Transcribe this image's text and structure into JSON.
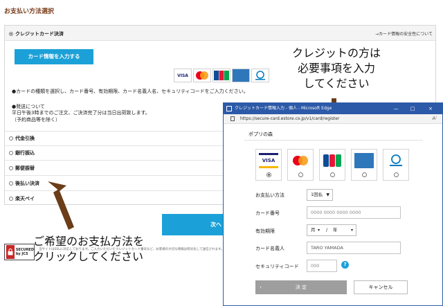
{
  "page": {
    "section_title": "お支払い方法選択",
    "credit_label": "クレジットカード決済",
    "security_link": "→カード情報の安全性について",
    "card_button": "カード情報を入力する",
    "card_logos": [
      "VISA",
      "MasterCard",
      "JCB",
      "AMEX",
      "Diners Club"
    ],
    "notice_line1": "●カードの種類を選択し、カード番号、有効期限、カード名義人名、セキュリティコードをご入力ください。",
    "notice_ship_title": "●発送について",
    "notice_ship_line1": "平日午後3時までのご注文、ご決済完了分は当日出荷致します。",
    "notice_ship_line2": "（予約商品等を除く）",
    "methods": [
      "代金引換",
      "銀行振込",
      "郵便振替",
      "後払い決済",
      "楽天ペイ"
    ],
    "next_button": "次へ",
    "seal_line1": "SECURED",
    "seal_line2": "by JCS",
    "ssl_text": "当サイトはSSLに対応しております。ご入力いただいたクレジットカード番号など、お客様の大切な情報は暗号化して送信されます。"
  },
  "annotations": {
    "top_line1": "クレジットの方は",
    "top_line2": "必要事項を入力",
    "top_line3": "してください",
    "bottom_line1": "ご希望のお支払方法を",
    "bottom_line2": "クリックしてください"
  },
  "popup": {
    "title": "クレジットカード情報入力 - 個人 - Microsoft Edge",
    "controls": [
      "—",
      "□",
      "×"
    ],
    "url": "https://secure-card.estore.co.jp/v1/card/register",
    "reader_icon": "A⁾",
    "shop_name": "ポプリの森",
    "brands": [
      {
        "name": "VISA",
        "selected": true
      },
      {
        "name": "MasterCard",
        "selected": false
      },
      {
        "name": "JCB",
        "selected": false
      },
      {
        "name": "AMEX",
        "selected": false
      },
      {
        "name": "Diners Club",
        "selected": false
      }
    ],
    "fields": {
      "payment_label": "お支払い方法",
      "payment_value": "1回払",
      "number_label": "カード番号",
      "number_placeholder": "0000 0000 0000 0000",
      "expiry_label": "有効期限",
      "expiry_month": "月",
      "expiry_sep": "/",
      "expiry_year": "年",
      "holder_label": "カード名義人",
      "holder_placeholder": "TARO YAMADA",
      "cvc_label": "セキュリティコード",
      "cvc_placeholder": "000"
    },
    "submit_label": "決 定",
    "cancel_label": "キャンセル"
  },
  "colors": {
    "accent": "#1ba1d8",
    "arrow": "#6b3d18",
    "title_text": "#7a3e1c",
    "window_bar": "#2d5aa8"
  }
}
